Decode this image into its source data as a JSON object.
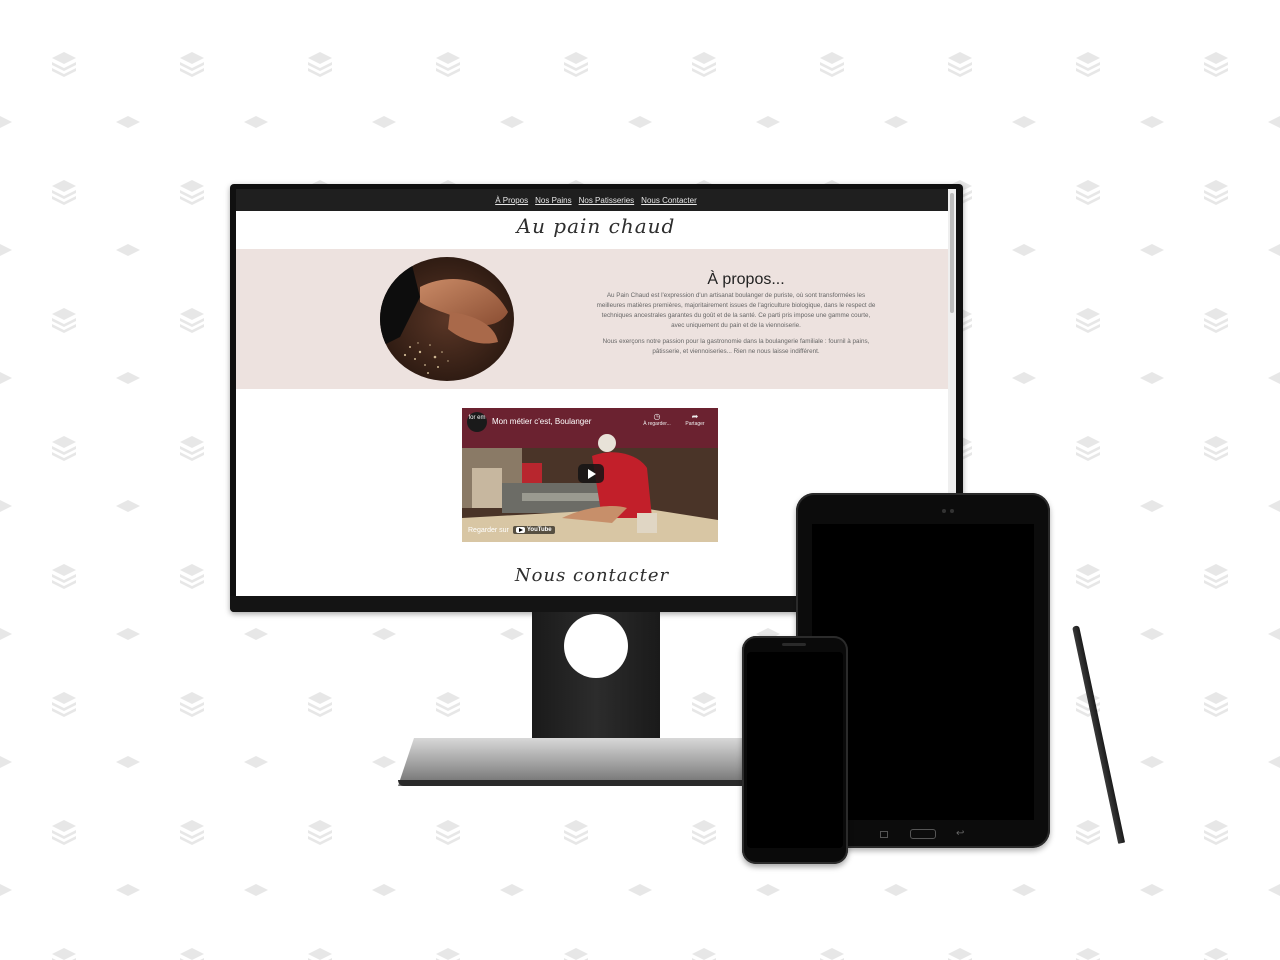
{
  "website": {
    "nav": {
      "links": [
        "À Propos",
        "Nos Pains",
        "Nos Patisseries",
        "Nous Contacter"
      ]
    },
    "site_title": "Au pain chaud",
    "about": {
      "heading": "À propos...",
      "paragraph1": "Au Pain Chaud est l'expression d'un artisanat boulanger de puriste, où sont transformées les meilleures matières premières, majoritairement issues de l'agriculture biologique, dans le respect de techniques ancestrales garantes du goût et de la santé. Ce parti pris impose une gamme courte, avec uniquement du pain et de la viennoiserie.",
      "paragraph2": "Nous exerçons notre passion pour la gastronomie dans la boulangerie familiale : fournil à pains, pâtisserie, et viennoiseries... Rien ne nous laisse indifférent."
    },
    "video": {
      "channel_logo": "for em",
      "title": "Mon métier c'est, Boulanger",
      "watch_later_label": "À regarder...",
      "share_label": "Partager",
      "watch_on_label": "Regarder sur",
      "platform": "YouTube"
    },
    "contact_title": "Nous contacter"
  },
  "devices": [
    "monitor",
    "tablet",
    "smartphone",
    "stylus"
  ],
  "colors": {
    "nav_bg": "#1f1f1f",
    "about_band_bg": "#ede2df",
    "device_body": "#0c0c0c"
  }
}
